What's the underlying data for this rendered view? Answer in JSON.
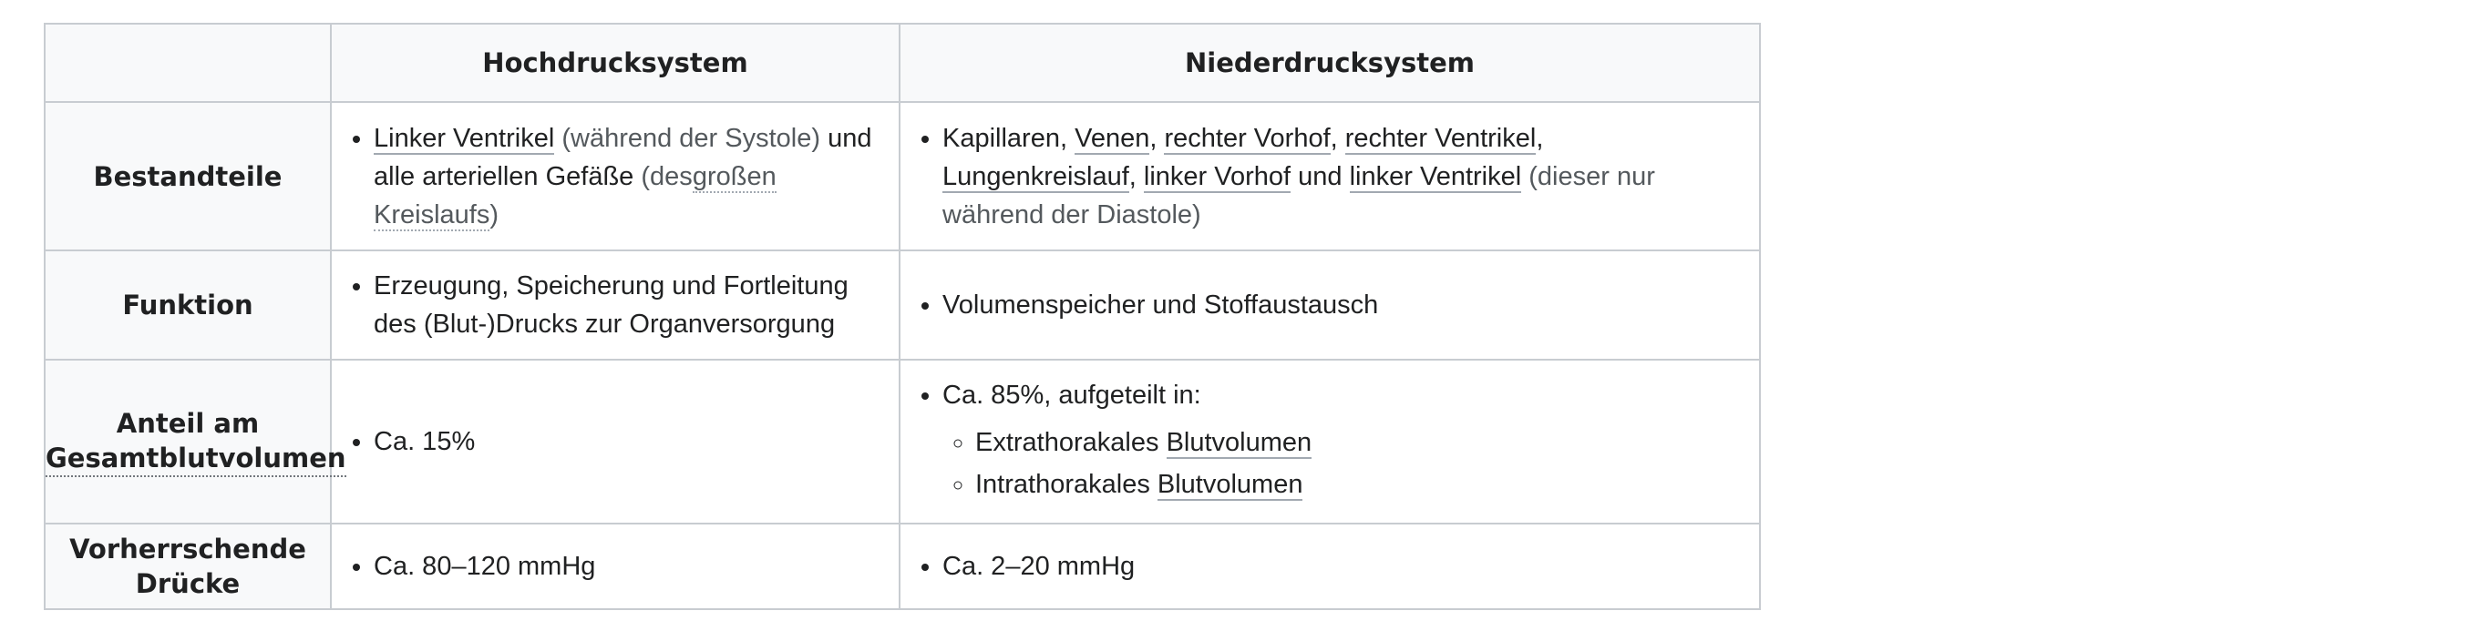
{
  "header": {
    "empty": "",
    "col1": "Hochdrucksystem",
    "col2": "Niederdrucksystem"
  },
  "rows": {
    "bestandteile": {
      "label": "Bestandteile",
      "hoch": {
        "link1": "Linker Ventrikel",
        "paren1": "(während der Systole)",
        "t1": "und alle arteriellen Gefäße",
        "paren2_open": "(des",
        "link2": "großen Kreislaufs",
        "paren2_close": ")"
      },
      "nieder": {
        "t_kap": "Kapillaren,",
        "link_venen": "Venen",
        "sep1": ",",
        "link_rvorhof": "rechter Vorhof",
        "sep2": ",",
        "link_rventrikel": "rechter Ventrikel",
        "sep3": ",",
        "link_lungen": "Lungenkreislauf",
        "sep4": ",",
        "link_lvorhof": "linker Vorhof",
        "t_und": "und",
        "link_lventrikel": "linker Ventrikel",
        "paren": "(dieser nur während der Diastole)"
      }
    },
    "funktion": {
      "label": "Funktion",
      "hoch": "Erzeugung, Speicherung und Fortleitung des (Blut-)Drucks zur Organversorgung",
      "nieder": "Volumenspeicher und Stoffaustausch"
    },
    "anteil": {
      "label_line1": "Anteil am",
      "label_link": "Gesamtblutvolumen",
      "hoch": "Ca. 15%",
      "nieder_main": "Ca. 85%, aufgeteilt in:",
      "sub1_text": "Extrathorakales",
      "sub1_link": "Blutvolumen",
      "sub2_text": "Intrathorakales",
      "sub2_link": "Blutvolumen"
    },
    "druecke": {
      "label_line1": "Vorherrschende",
      "label_line2": "Drücke",
      "hoch": "Ca. 80–120 mmHg",
      "nieder": "Ca. 2–20 mmHg"
    }
  }
}
